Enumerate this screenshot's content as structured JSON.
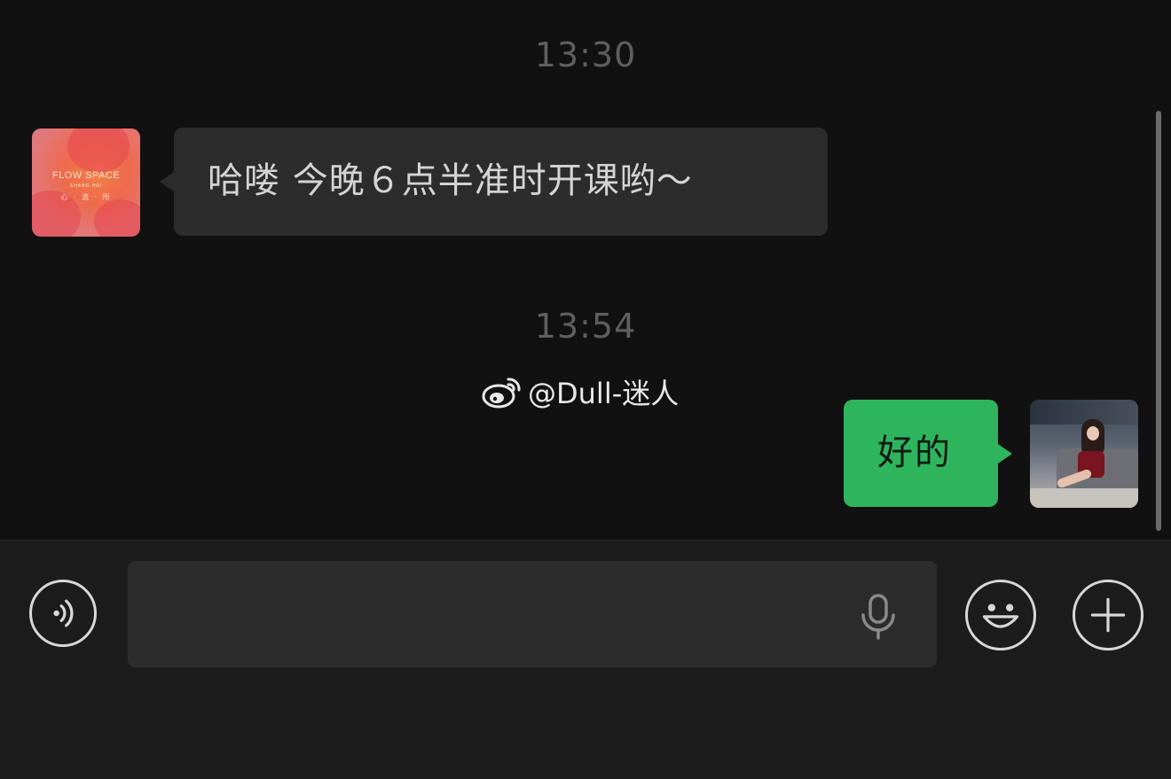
{
  "chat": {
    "timestamps": [
      "13:30",
      "13:54"
    ],
    "messages": [
      {
        "direction": "incoming",
        "text": "哈喽 今晚６点半准时开课哟～"
      },
      {
        "direction": "outgoing",
        "text": "好的"
      }
    ],
    "incoming_avatar": {
      "logo_text": "FLOW SPACE",
      "logo_subtext": "SHANG HAI",
      "logo_cn": "心 · 流 · 所"
    }
  },
  "watermark": {
    "icon": "weibo-icon",
    "text": "@Dull-迷人"
  },
  "input_bar": {
    "voice_icon": "voice-icon",
    "input_value": "",
    "mic_icon": "microphone-icon",
    "emoji_icon": "emoji-icon",
    "plus_icon": "plus-icon"
  },
  "colors": {
    "background": "#111111",
    "incoming_bubble": "#2c2c2c",
    "outgoing_bubble": "#2fb45e",
    "timestamp": "#5f5f5f",
    "input_bar": "#1c1c1c"
  }
}
